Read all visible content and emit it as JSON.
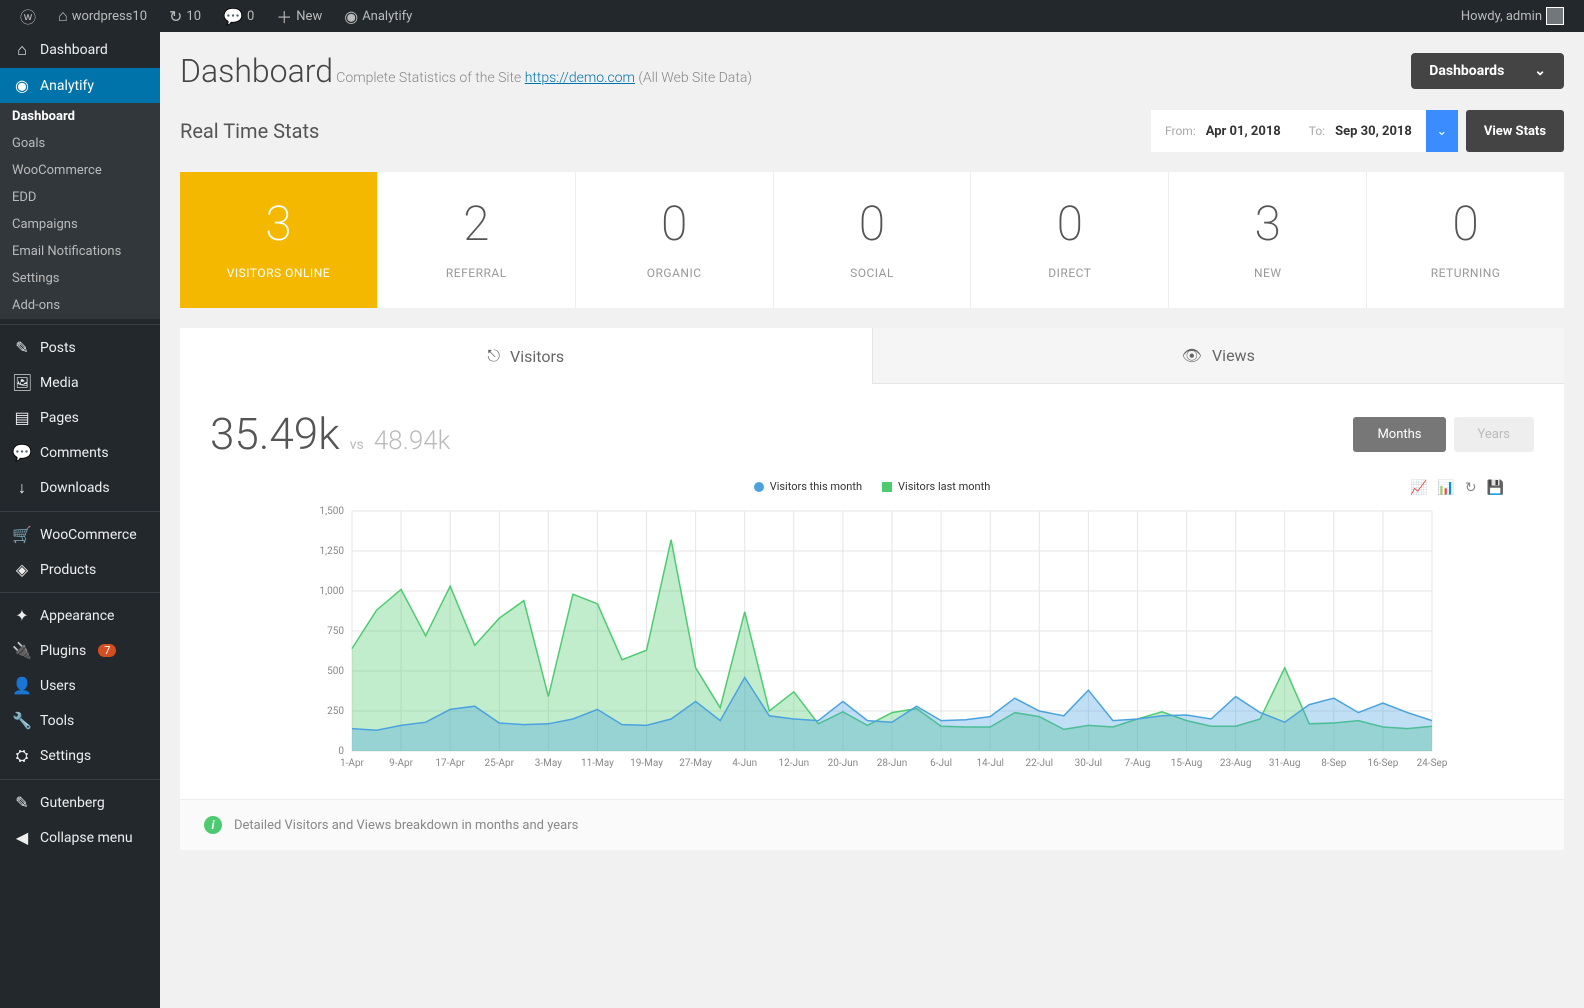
{
  "topbar": {
    "site": "wordpress10",
    "updates": "10",
    "comments": "0",
    "new": "New",
    "analytify": "Analytify",
    "greeting": "Howdy, admin"
  },
  "sidebar": {
    "items": [
      {
        "icon": "⌂",
        "label": "Dashboard"
      },
      {
        "icon": "◉",
        "label": "Analytify",
        "active": true
      }
    ],
    "submenu": [
      "Dashboard",
      "Goals",
      "WooCommerce",
      "EDD",
      "Campaigns",
      "Email Notifications",
      "Settings",
      "Add-ons"
    ],
    "items2": [
      {
        "icon": "✎",
        "label": "Posts"
      },
      {
        "icon": "🖼",
        "label": "Media"
      },
      {
        "icon": "▤",
        "label": "Pages"
      },
      {
        "icon": "💬",
        "label": "Comments"
      },
      {
        "icon": "↓",
        "label": "Downloads"
      }
    ],
    "items3": [
      {
        "icon": "🛒",
        "label": "WooCommerce"
      },
      {
        "icon": "◈",
        "label": "Products"
      }
    ],
    "items4": [
      {
        "icon": "✦",
        "label": "Appearance"
      },
      {
        "icon": "🔌",
        "label": "Plugins",
        "badge": "7"
      },
      {
        "icon": "👤",
        "label": "Users"
      },
      {
        "icon": "🔧",
        "label": "Tools"
      },
      {
        "icon": "⛭",
        "label": "Settings"
      }
    ],
    "items5": [
      {
        "icon": "✎",
        "label": "Gutenberg"
      },
      {
        "icon": "◀",
        "label": "Collapse menu"
      }
    ]
  },
  "page": {
    "title": "Dashboard",
    "subtitle": "Complete Statistics of the Site",
    "site_url": "https://demo.com",
    "data_scope": "(All Web Site Data)",
    "dropdown": "Dashboards"
  },
  "stats": {
    "heading": "Real Time Stats",
    "from_label": "From:",
    "from": "Apr 01, 2018",
    "to_label": "To:",
    "to": "Sep 30, 2018",
    "view_btn": "View Stats",
    "cards": [
      {
        "value": "3",
        "label": "VISITORS ONLINE",
        "active": true
      },
      {
        "value": "2",
        "label": "REFERRAL"
      },
      {
        "value": "0",
        "label": "ORGANIC"
      },
      {
        "value": "0",
        "label": "SOCIAL"
      },
      {
        "value": "0",
        "label": "DIRECT"
      },
      {
        "value": "3",
        "label": "NEW"
      },
      {
        "value": "0",
        "label": "RETURNING"
      }
    ]
  },
  "chart": {
    "tabs": [
      "Visitors",
      "Views"
    ],
    "main": "35.49k",
    "vs": "vs",
    "sub": "48.94k",
    "toggle": [
      "Months",
      "Years"
    ],
    "legend": [
      "Visitors this month",
      "Visitors last month"
    ],
    "footer": "Detailed Visitors and Views breakdown in months and years"
  },
  "chart_data": {
    "type": "line",
    "xlabel": "",
    "ylabel": "",
    "ylim": [
      0,
      1500
    ],
    "yticks": [
      0,
      250,
      500,
      750,
      1000,
      1250,
      1500
    ],
    "categories": [
      "1-Apr",
      "9-Apr",
      "17-Apr",
      "25-Apr",
      "3-May",
      "11-May",
      "19-May",
      "27-May",
      "4-Jun",
      "12-Jun",
      "20-Jun",
      "28-Jun",
      "6-Jul",
      "14-Jul",
      "22-Jul",
      "30-Jul",
      "7-Aug",
      "15-Aug",
      "23-Aug",
      "31-Aug",
      "8-Sep",
      "16-Sep",
      "24-Sep"
    ],
    "series": [
      {
        "name": "Visitors this month",
        "color": "#4aa3df",
        "values": [
          140,
          130,
          160,
          180,
          260,
          280,
          175,
          165,
          170,
          200,
          260,
          165,
          160,
          200,
          310,
          190,
          460,
          220,
          200,
          190,
          310,
          190,
          180,
          280,
          190,
          195,
          215,
          330,
          250,
          220,
          380,
          190,
          200,
          220,
          225,
          200,
          340,
          240,
          180,
          290,
          330,
          240,
          300,
          240,
          190
        ]
      },
      {
        "name": "Visitors last month",
        "color": "#4ecb71",
        "values": [
          640,
          880,
          1010,
          720,
          1030,
          660,
          830,
          940,
          340,
          980,
          920,
          570,
          630,
          1320,
          520,
          270,
          870,
          250,
          370,
          170,
          245,
          160,
          240,
          265,
          155,
          150,
          150,
          240,
          215,
          135,
          160,
          150,
          200,
          245,
          190,
          155,
          155,
          200,
          520,
          170,
          175,
          190,
          150,
          140,
          155
        ]
      }
    ]
  }
}
